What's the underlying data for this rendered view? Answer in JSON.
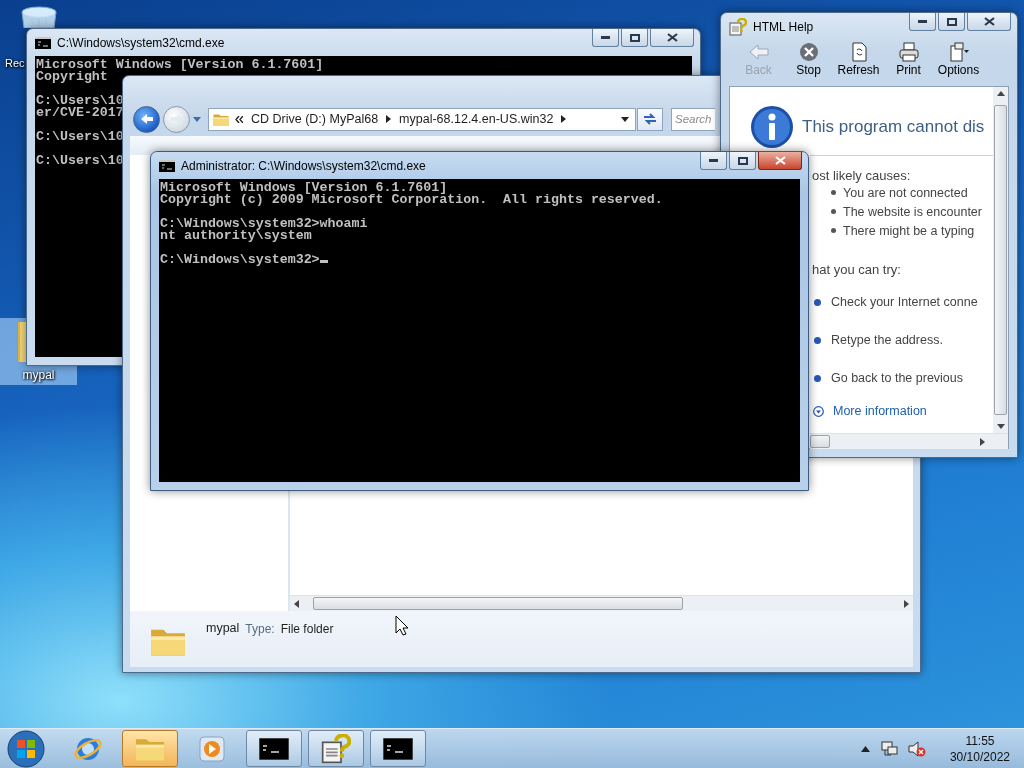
{
  "desktop_icons": [
    {
      "kind": "recycle_bin",
      "label": "Rec",
      "selected": false
    },
    {
      "kind": "folder",
      "label": "mypal",
      "selected": true
    }
  ],
  "windows": [
    {
      "kind": "console",
      "title": "C:\\Windows\\system32\\cmd.exe",
      "active": false,
      "paragraphs": [
        [
          "Microsoft Windows [Version 6.1.7601]",
          "Copyright"
        ],
        [
          "C:\\Users\\10",
          "er/CVE-2017"
        ],
        [
          "C:\\Users\\10"
        ],
        [
          "C:\\Users\\10"
        ]
      ]
    },
    {
      "kind": "explorer",
      "active": false,
      "breadcrumb": [
        "CD Drive (D:) MyPal68",
        "mypal-68.12.4.en-US.win32"
      ],
      "search": {
        "placeholder": "Search"
      },
      "details": {
        "name": "mypal",
        "type_label": "Type:",
        "type": "File folder"
      }
    },
    {
      "kind": "console",
      "title": "Administrator: C:\\Windows\\system32\\cmd.exe",
      "active": true,
      "cursor": true,
      "paragraphs": [
        [
          "Microsoft Windows [Version 6.1.7601]",
          "Copyright (c) 2009 Microsoft Corporation.  All rights reserved."
        ],
        [
          "C:\\Windows\\system32>whoami",
          "nt authority\\system"
        ],
        [
          "C:\\Windows\\system32>"
        ]
      ]
    },
    {
      "kind": "help",
      "title": "HTML Help",
      "active": false,
      "toolbar": [
        {
          "kind": "back",
          "label": "Back",
          "disabled": true
        },
        {
          "kind": "stop",
          "label": "Stop",
          "disabled": false
        },
        {
          "kind": "refresh",
          "label": "Refresh",
          "disabled": false
        },
        {
          "kind": "print",
          "label": "Print",
          "disabled": false
        },
        {
          "kind": "options",
          "label": "Options",
          "disabled": false
        }
      ],
      "heading": "This program cannot dis",
      "causes_title": "ost likely causes:",
      "causes": [
        "You are not connected",
        "The website is encounter",
        "There might be a typing"
      ],
      "try_title": "hat you can try:",
      "tries": [
        "Check your Internet conne",
        "Retype the address.",
        "Go back to the previous"
      ],
      "more": "More information"
    }
  ],
  "taskbar": {
    "buttons": [
      {
        "kind": "browser",
        "running": false,
        "highlighted": false
      },
      {
        "kind": "explorer",
        "running": true,
        "highlighted": true
      },
      {
        "kind": "media",
        "running": false,
        "highlighted": false
      },
      {
        "kind": "console",
        "running": true,
        "highlighted": false
      },
      {
        "kind": "help",
        "running": true,
        "highlighted": false
      },
      {
        "kind": "console",
        "running": true,
        "highlighted": false
      }
    ],
    "tray": {
      "time": "11:55",
      "date": "30/10/2022",
      "sound_muted": true
    }
  }
}
